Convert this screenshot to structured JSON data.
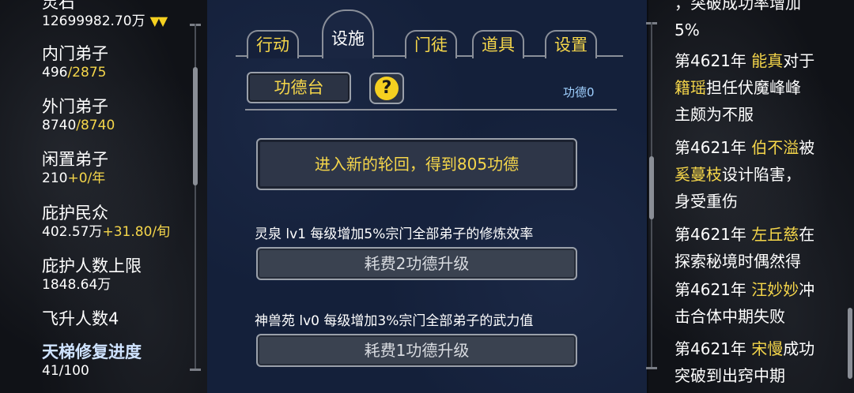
{
  "stats": {
    "spirit_stone_label": "灵石",
    "spirit_stone_value": "12699982.70万",
    "inner_label": "内门弟子",
    "inner_current": "496",
    "inner_max": "/2875",
    "outer_label": "外门弟子",
    "outer_current": "8740",
    "outer_max": "/8740",
    "idle_label": "闲置弟子",
    "idle_current": "210",
    "idle_rate": "+0/年",
    "protected_label": "庇护民众",
    "protected_current": "402.57万",
    "protected_rate": "+31.80/旬",
    "protect_cap_label": "庇护人数上限",
    "protect_cap_value": "1848.64万",
    "ascended_label": "飞升人数4",
    "ladder_label": "天梯修复进度",
    "ladder_value": "41/100"
  },
  "tabs": [
    {
      "label": "行动"
    },
    {
      "label": "设施"
    },
    {
      "label": "门徒"
    },
    {
      "label": "道具"
    },
    {
      "label": "设置"
    }
  ],
  "facility": {
    "title": "功德台",
    "help": "?",
    "merit": "功德0",
    "reincarnate": "进入新的轮回，得到805功德",
    "upgrades": [
      {
        "desc": "灵泉 lv1 每级增加5%宗门全部弟子的修炼效率",
        "button": "耗费2功德升级"
      },
      {
        "desc": "神兽苑 lv0 每级增加3%宗门全部弟子的武力值",
        "button": "耗费1功德升级"
      }
    ]
  },
  "log": [
    {
      "line1": "，突破成功率增加",
      "line2": "5%"
    },
    {
      "year": "第4621年",
      "name1": "能真",
      "text1": "对于",
      "name2": "籍瑶",
      "text2": "担任伏魔峰峰",
      "text3": "主颇为不服"
    },
    {
      "year": "第4621年",
      "name1": "伯不溢",
      "text1": "被",
      "name2": "奚蔓枝",
      "text2": "设计陷害，",
      "text3": "身受重伤"
    },
    {
      "year": "第4621年",
      "name1": "左丘慈",
      "text1": "在",
      "text2": "探索秘境时偶然得"
    },
    {
      "year": "第4621年",
      "name1": "汪妙妙",
      "text1": "冲",
      "text2": "击合体中期失败"
    },
    {
      "year": "第4621年",
      "name1": "宋慢",
      "text1": "成功",
      "text2": "突破到出窍中期"
    }
  ],
  "colors": {
    "accent": "#f5d64a",
    "panel": "#14203a",
    "merit": "#9fd0ff"
  }
}
